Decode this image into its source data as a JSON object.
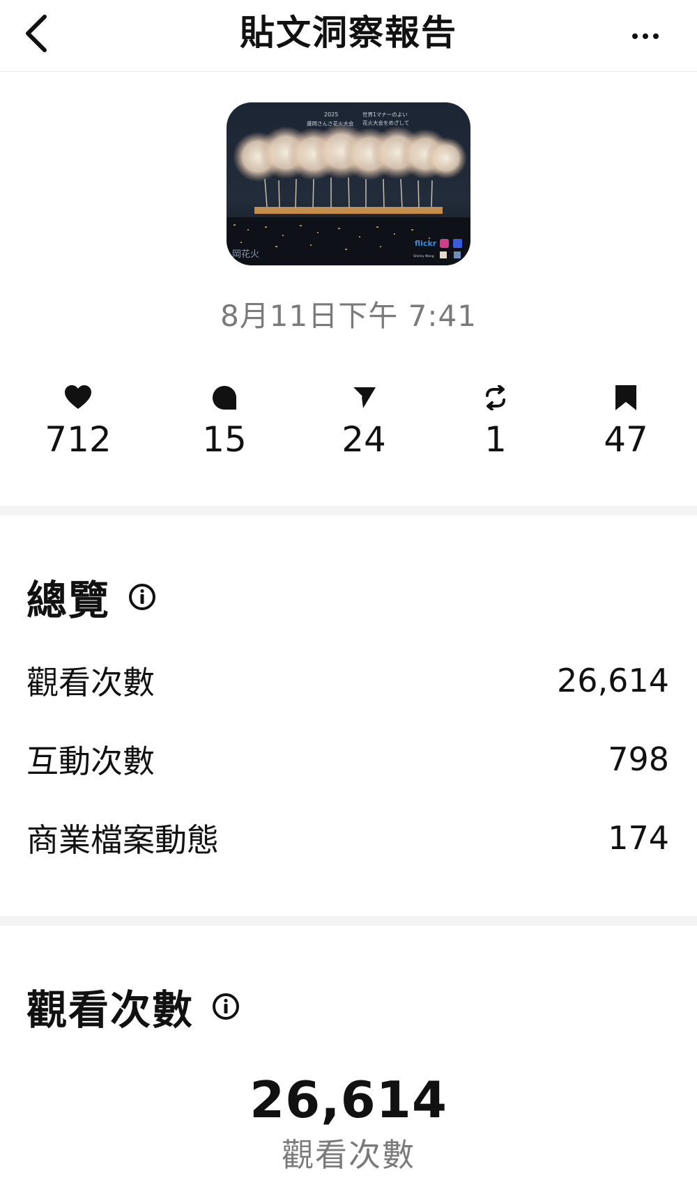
{
  "header": {
    "title": "貼文洞察報告",
    "back_icon": "chevron-left-icon",
    "more_icon": "more-horizontal-icon"
  },
  "post": {
    "thumbnail_alt": "fireworks photo",
    "thumbnail_text": {
      "year": "2025",
      "left_caption": "盛岡さんさ花火大会",
      "right_caption_1": "世界1マナーのよい",
      "right_caption_2": "花火大会をめざして",
      "brand": "flickr",
      "signature": "岡花火",
      "credit": "Shirley Wang"
    },
    "time": "8月11日下午 7:41"
  },
  "stats": [
    {
      "icon": "heart-icon",
      "value": "712"
    },
    {
      "icon": "comment-icon",
      "value": "15"
    },
    {
      "icon": "send-icon",
      "value": "24"
    },
    {
      "icon": "repost-icon",
      "value": "1"
    },
    {
      "icon": "bookmark-icon",
      "value": "47"
    }
  ],
  "overview": {
    "title": "總覽",
    "rows": [
      {
        "label": "觀看次數",
        "value": "26,614"
      },
      {
        "label": "互動次數",
        "value": "798"
      },
      {
        "label": "商業檔案動態",
        "value": "174"
      }
    ]
  },
  "views": {
    "title": "觀看次數",
    "total": "26,614",
    "label": "觀看次數"
  },
  "colors": {
    "text": "#111111",
    "muted": "#7a7a7a",
    "divider": "#f4f4f4"
  }
}
